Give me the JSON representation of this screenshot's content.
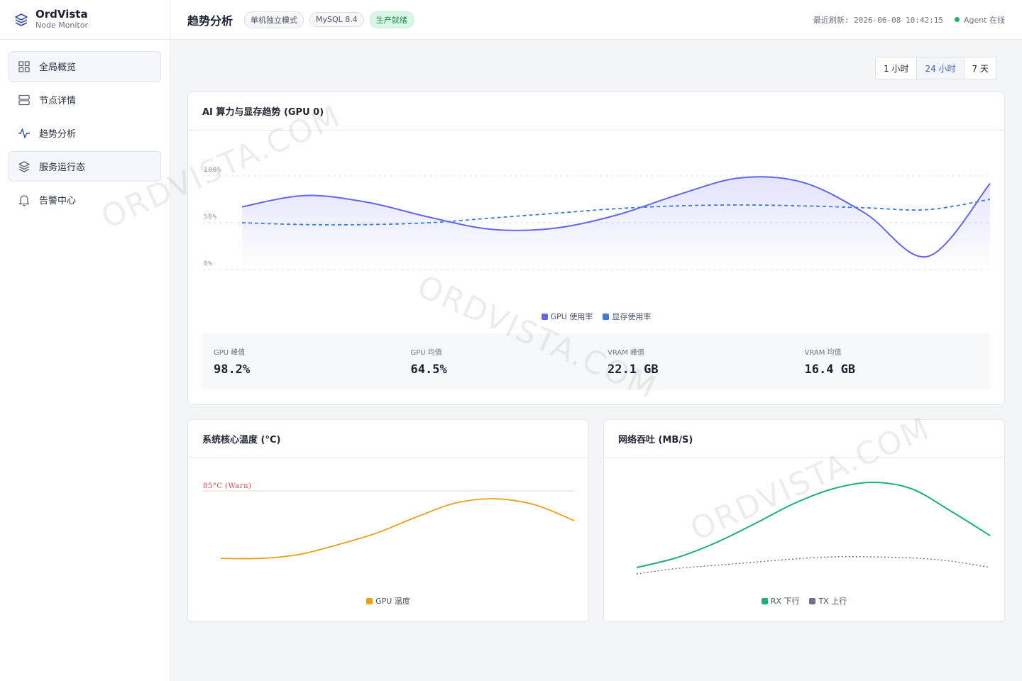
{
  "brand": {
    "title": "OrdVista",
    "subtitle": "Node Monitor",
    "logo_icon": "layers-icon"
  },
  "sidebar": {
    "items": [
      {
        "label": "全局概览",
        "icon": "grid-icon",
        "active": true
      },
      {
        "label": "节点详情",
        "icon": "server-icon",
        "active": false
      },
      {
        "label": "趋势分析",
        "icon": "activity-icon",
        "active": false
      },
      {
        "label": "服务运行态",
        "icon": "layers-icon",
        "active": true
      },
      {
        "label": "告警中心",
        "icon": "bell-icon",
        "active": false
      }
    ]
  },
  "header": {
    "title": "趋势分析",
    "badges": [
      "单机独立模式",
      "MySQL 8.4",
      "生产就绪"
    ],
    "refresh_label": "最近刷新: 2026-06-08 10:42:15",
    "agent_status": "Agent 在线",
    "status_color": "#18b866"
  },
  "range": {
    "options": [
      "1 小时",
      "24 小时",
      "7 天"
    ],
    "selected": "24 小时"
  },
  "gpu_card": {
    "title": "AI 算力与显存趋势 (GPU 0)",
    "stats": [
      {
        "label": "GPU 峰值",
        "value": "98.2%"
      },
      {
        "label": "GPU 均值",
        "value": "64.5%"
      },
      {
        "label": "VRAM 峰值",
        "value": "22.1 GB"
      },
      {
        "label": "VRAM 均值",
        "value": "16.4 GB"
      }
    ]
  },
  "temp_card": {
    "title": "系统核心温度 (°C)"
  },
  "net_card": {
    "title": "网络吞吐 (MB/S)"
  },
  "watermark": "ORDVISTA.COM",
  "chart_data": [
    {
      "type": "area",
      "ytick_labels": [
        "100%",
        "50%",
        "0%"
      ],
      "ylim": [
        0,
        100
      ],
      "grid": true,
      "legend": "bottom-center",
      "x": [
        0,
        1,
        2,
        3,
        4,
        5,
        6,
        7,
        8,
        9,
        10,
        11,
        12
      ],
      "series": [
        {
          "name": "GPU 使用率",
          "color": "#6366f1",
          "style": "solid-area",
          "values": [
            67,
            79,
            72,
            56,
            43,
            44,
            58,
            80,
            98,
            93,
            60,
            14,
            92
          ]
        },
        {
          "name": "显存使用率",
          "color": "#3b7ddd",
          "style": "dashed",
          "values": [
            50,
            48,
            48,
            50,
            55,
            60,
            65,
            68,
            69,
            68,
            66,
            64,
            75
          ]
        }
      ]
    },
    {
      "type": "line",
      "annotations": [
        "85°C (Warn)"
      ],
      "threshold": 85,
      "ylim": [
        40,
        90
      ],
      "legend": "bottom-center",
      "x": [
        0,
        1,
        2,
        3,
        4,
        5,
        6,
        7,
        8,
        9
      ],
      "series": [
        {
          "name": "GPU 温度",
          "color": "#e9a11c",
          "style": "solid",
          "values": [
            51,
            51,
            53,
            58,
            64,
            72,
            79,
            81,
            78,
            70
          ]
        }
      ]
    },
    {
      "type": "line",
      "ylim": [
        0,
        100
      ],
      "legend": "bottom-center",
      "x": [
        0,
        1,
        2,
        3,
        4,
        5,
        6,
        7,
        8,
        9
      ],
      "series": [
        {
          "name": "RX 下行",
          "color": "#19b07a",
          "style": "solid",
          "values": [
            12,
            21,
            35,
            53,
            72,
            86,
            92,
            86,
            65,
            42
          ]
        },
        {
          "name": "TX 上行",
          "color": "#6b7384",
          "style": "dotted",
          "values": [
            6,
            11,
            14,
            17,
            20,
            22,
            22,
            21,
            18,
            12
          ]
        }
      ]
    }
  ]
}
